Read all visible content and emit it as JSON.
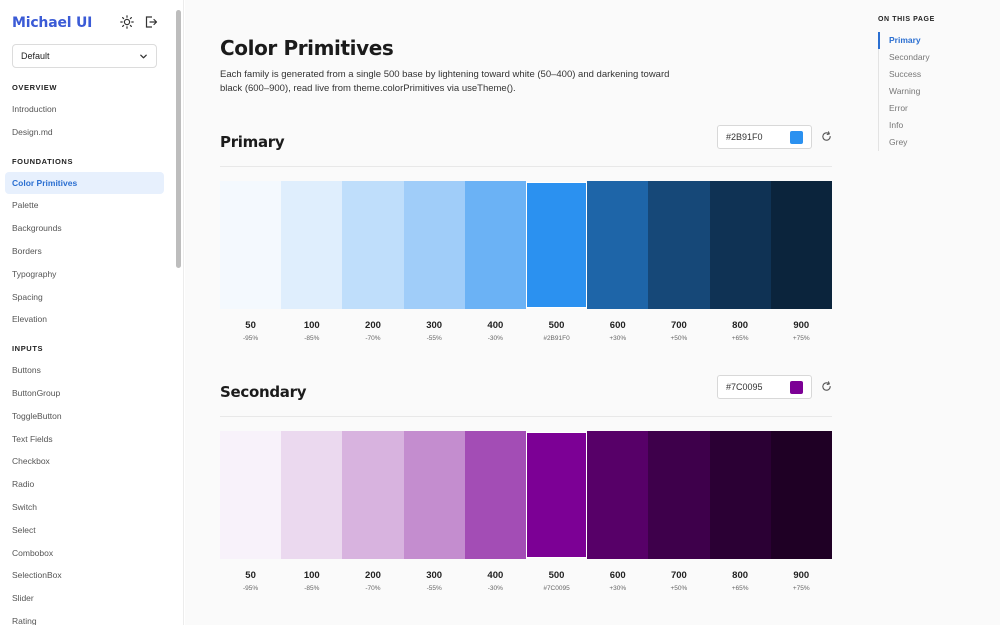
{
  "app": {
    "brand": "Michael UI",
    "theme_select": "Default"
  },
  "sidebar": {
    "sections": [
      {
        "title": "OVERVIEW",
        "items": [
          "Introduction",
          "Design.md"
        ]
      },
      {
        "title": "FOUNDATIONS",
        "items": [
          "Color Primitives",
          "Palette",
          "Backgrounds",
          "Borders",
          "Typography",
          "Spacing",
          "Elevation"
        ]
      },
      {
        "title": "INPUTS",
        "items": [
          "Buttons",
          "ButtonGroup",
          "ToggleButton",
          "Text Fields",
          "Checkbox",
          "Radio",
          "Switch",
          "Select",
          "Combobox",
          "SelectionBox",
          "Slider",
          "Rating"
        ]
      }
    ],
    "active_item": "Color Primitives"
  },
  "main": {
    "title": "Color Primitives",
    "description": "Each family is generated from a single 500 base by lightening toward white (50–400) and darkening toward black (600–900), read live from theme.colorPrimitives via useTheme().",
    "families": [
      {
        "name": "Primary",
        "hex": "#2B91F0",
        "shades": [
          {
            "shade": "50",
            "note": "-95%",
            "color": "#f4f9fe"
          },
          {
            "shade": "100",
            "note": "-85%",
            "color": "#dfeefd"
          },
          {
            "shade": "200",
            "note": "-70%",
            "color": "#bfdefb"
          },
          {
            "shade": "300",
            "note": "-55%",
            "color": "#a0cdf9"
          },
          {
            "shade": "400",
            "note": "-30%",
            "color": "#6bb2f5"
          },
          {
            "shade": "500",
            "note": "#2B91F0",
            "color": "#2b91f0"
          },
          {
            "shade": "600",
            "note": "+30%",
            "color": "#1e65a8"
          },
          {
            "shade": "700",
            "note": "+50%",
            "color": "#164878"
          },
          {
            "shade": "800",
            "note": "+65%",
            "color": "#0f3254"
          },
          {
            "shade": "900",
            "note": "+75%",
            "color": "#0b243c"
          }
        ]
      },
      {
        "name": "Secondary",
        "hex": "#7C0095",
        "shades": [
          {
            "shade": "50",
            "note": "-95%",
            "color": "#f8f2fa"
          },
          {
            "shade": "100",
            "note": "-85%",
            "color": "#ebd9ef"
          },
          {
            "shade": "200",
            "note": "-70%",
            "color": "#d8b3df"
          },
          {
            "shade": "300",
            "note": "-55%",
            "color": "#c48dcf"
          },
          {
            "shade": "400",
            "note": "-30%",
            "color": "#a34db5"
          },
          {
            "shade": "500",
            "note": "#7C0095",
            "color": "#7c0095"
          },
          {
            "shade": "600",
            "note": "+30%",
            "color": "#570068"
          },
          {
            "shade": "700",
            "note": "+50%",
            "color": "#3e004b"
          },
          {
            "shade": "800",
            "note": "+65%",
            "color": "#2b0034"
          },
          {
            "shade": "900",
            "note": "+75%",
            "color": "#1f0025"
          }
        ]
      }
    ]
  },
  "toc": {
    "title": "ON THIS PAGE",
    "items": [
      "Primary",
      "Secondary",
      "Success",
      "Warning",
      "Error",
      "Info",
      "Grey"
    ],
    "active": "Primary"
  }
}
